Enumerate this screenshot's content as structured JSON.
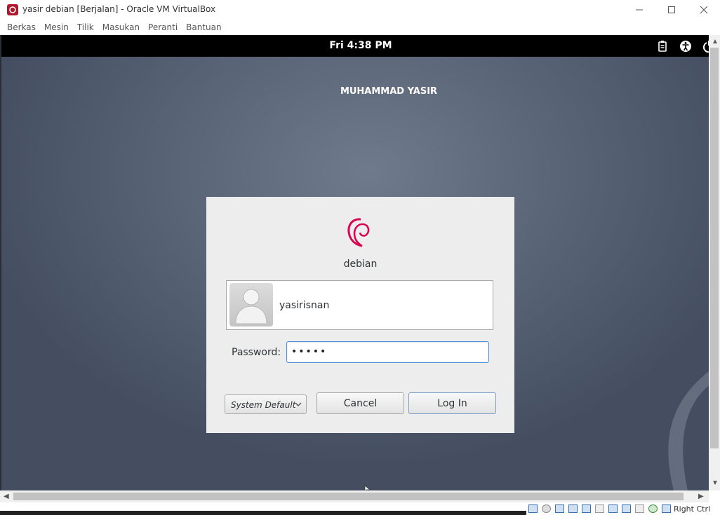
{
  "window": {
    "title": "yasir debian [Berjalan] - Oracle VM VirtualBox",
    "menu": [
      "Berkas",
      "Mesin",
      "Tilik",
      "Masukan",
      "Peranti",
      "Bantuan"
    ]
  },
  "vm": {
    "clock": "Fri  4:38 PM",
    "banner": "MUHAMMAD YASIR",
    "tray_icons": [
      "clipboard-battery-icon",
      "accessibility-icon",
      "power-icon"
    ]
  },
  "login": {
    "distro_name": "debian",
    "username": "yasirisnan",
    "password_label": "Password:",
    "password_value": "•••••",
    "session": "System Default",
    "cancel_label": "Cancel",
    "login_label": "Log In"
  },
  "statusbar": {
    "host_key": "Right Ctrl"
  },
  "colors": {
    "debian_red": "#d70751",
    "focus_blue": "#4a90d9"
  }
}
